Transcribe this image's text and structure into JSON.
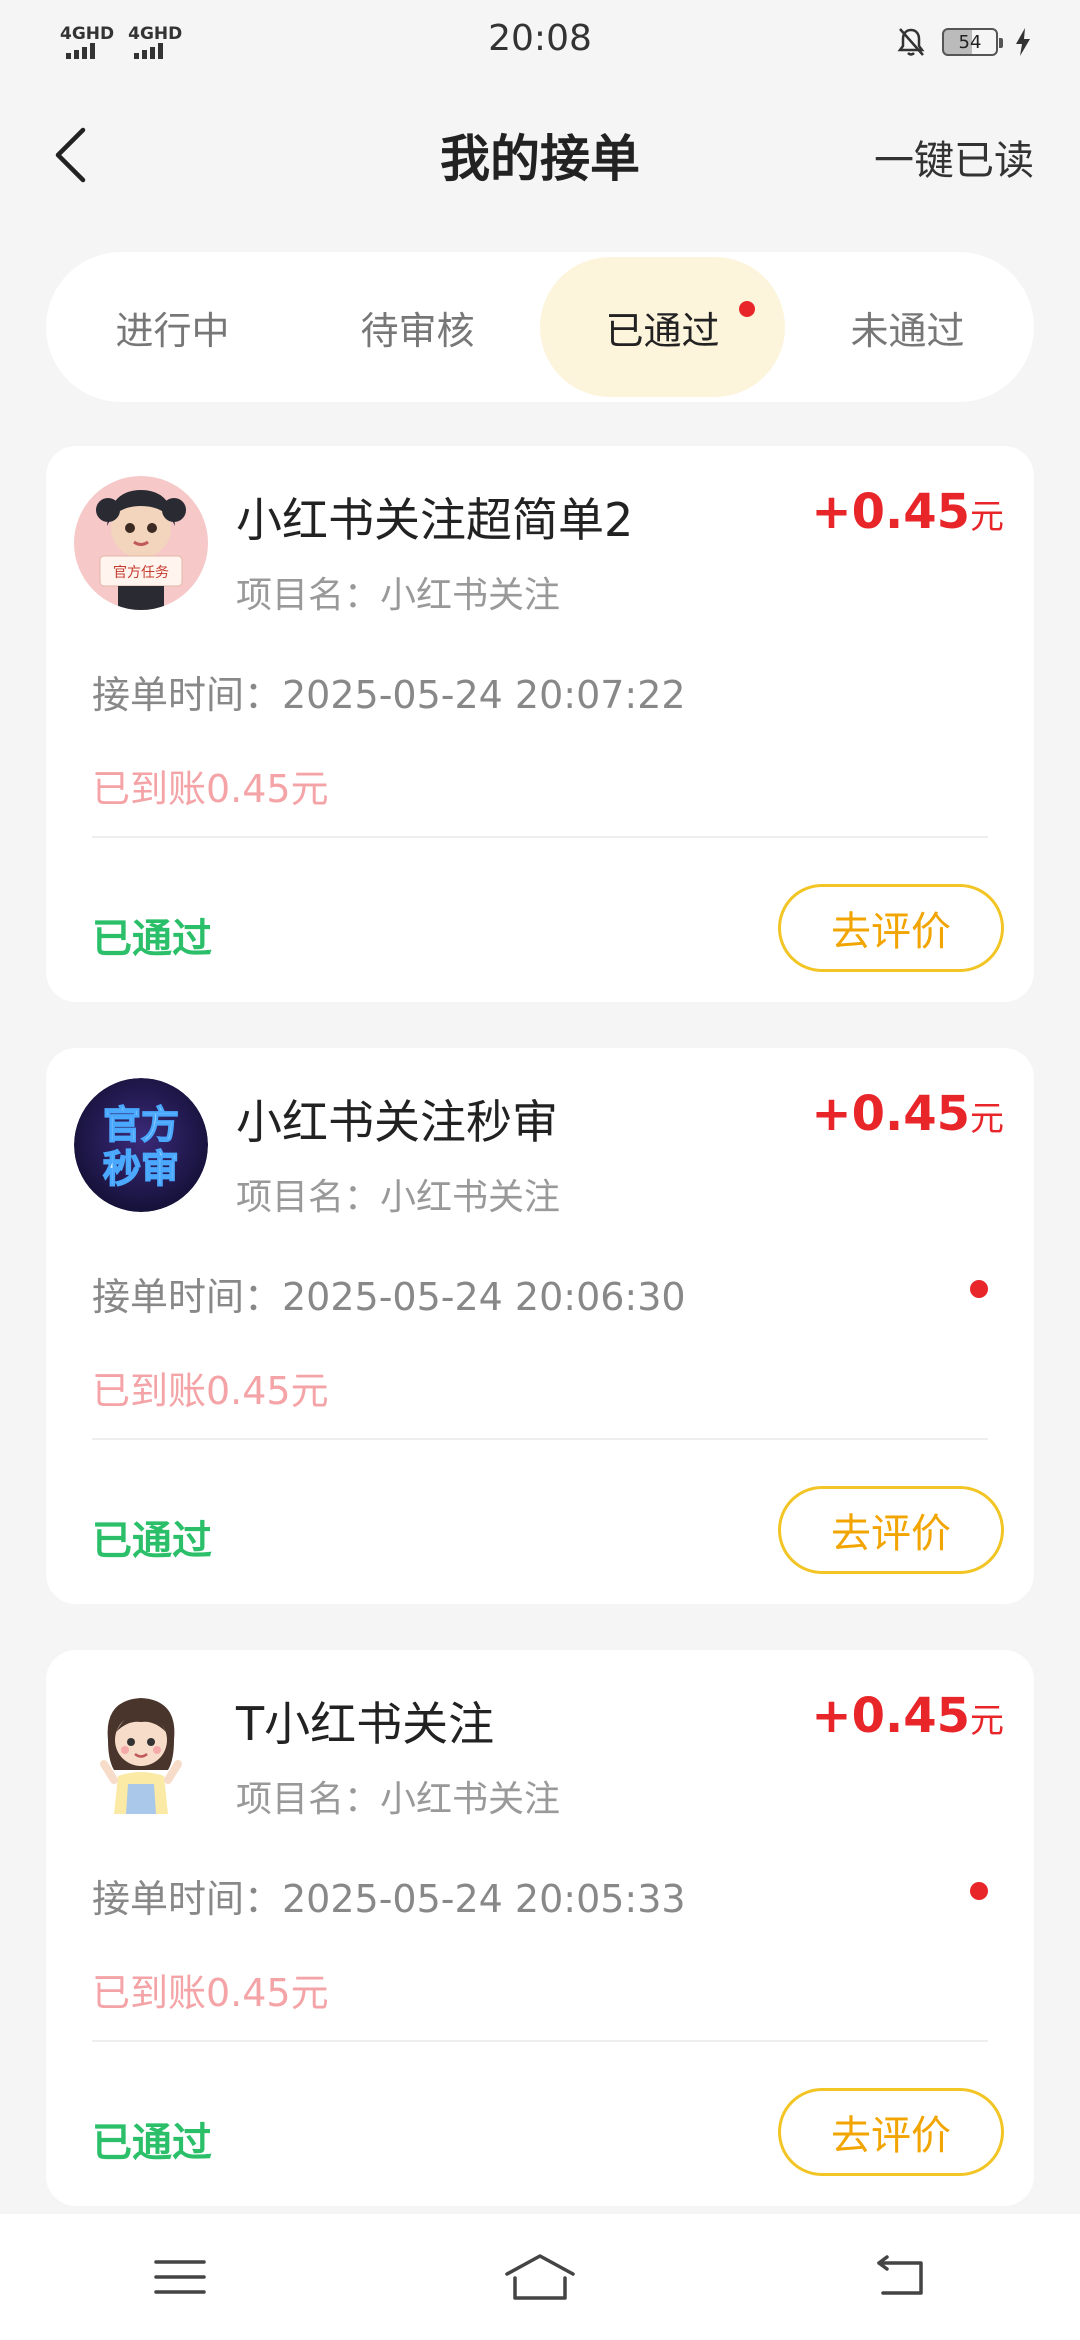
{
  "status_bar": {
    "signal1": "4GHD",
    "signal2": "4GHD",
    "time": "20:08",
    "battery": "54",
    "icons": [
      "bell-off-icon",
      "battery-icon",
      "charging-icon"
    ]
  },
  "header": {
    "title": "我的接单",
    "right_action": "一键已读"
  },
  "tabs": [
    {
      "label": "进行中",
      "active": false,
      "dot": false
    },
    {
      "label": "待审核",
      "active": false,
      "dot": false
    },
    {
      "label": "已通过",
      "active": true,
      "dot": true
    },
    {
      "label": "未通过",
      "active": false,
      "dot": false
    }
  ],
  "colors": {
    "accent_red": "#e8262a",
    "success_green": "#2bbf6a",
    "button_yellow": "#f2c524",
    "active_tab_bg": "#fdf4dc"
  },
  "orders": [
    {
      "title": "小红书关注超简单2",
      "reward": "+0.45",
      "unit": "元",
      "project": "项目名：小红书关注",
      "time": "接单时间：2025-05-24 20:07:22",
      "credited": "已到账0.45元",
      "status": "已通过",
      "action": "去评价",
      "avatar_text": "官方任务",
      "unread": false
    },
    {
      "title": "小红书关注秒审",
      "reward": "+0.45",
      "unit": "元",
      "project": "项目名：小红书关注",
      "time": "接单时间：2025-05-24 20:06:30",
      "credited": "已到账0.45元",
      "status": "已通过",
      "action": "去评价",
      "avatar_text": "官方秒审",
      "unread": true
    },
    {
      "title": "T小红书关注",
      "reward": "+0.45",
      "unit": "元",
      "project": "项目名：小红书关注",
      "time": "接单时间：2025-05-24 20:05:33",
      "credited": "已到账0.45元",
      "status": "已通过",
      "action": "去评价",
      "avatar_text": "",
      "unread": true
    }
  ],
  "navbar": [
    "menu-icon",
    "home-icon",
    "back-icon"
  ]
}
